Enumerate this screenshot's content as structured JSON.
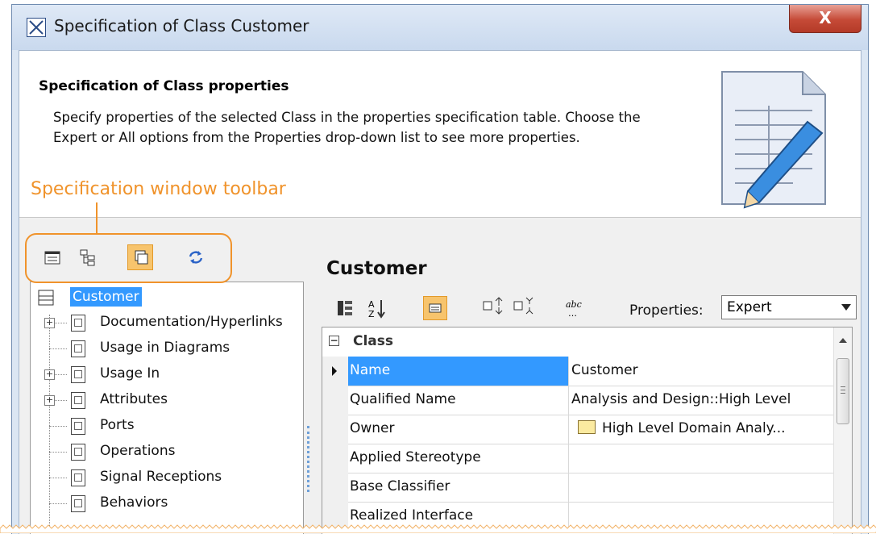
{
  "window": {
    "title": "Specification of Class Customer",
    "close_label": "X"
  },
  "header": {
    "title": "Specification of Class properties",
    "description": "Specify properties of the selected Class in the properties specification table. Choose the Expert or All options from the Properties drop-down list to see more properties."
  },
  "annotation": {
    "label": "Specification window toolbar",
    "color": "#f0932b"
  },
  "toolbar": {
    "buttons": [
      {
        "icon": "show-properties-icon",
        "active": false
      },
      {
        "icon": "show-tree-icon",
        "active": false
      },
      {
        "icon": "restore-window-icon",
        "active": true
      },
      {
        "icon": "refresh-icon",
        "active": false
      }
    ]
  },
  "tree": {
    "root": "Customer",
    "items": [
      {
        "label": "Documentation/Hyperlinks",
        "expandable": true
      },
      {
        "label": "Usage in Diagrams",
        "expandable": false
      },
      {
        "label": "Usage In",
        "expandable": true
      },
      {
        "label": "Attributes",
        "expandable": true
      },
      {
        "label": "Ports",
        "expandable": false
      },
      {
        "label": "Operations",
        "expandable": false
      },
      {
        "label": "Signal Receptions",
        "expandable": false
      },
      {
        "label": "Behaviors",
        "expandable": false
      }
    ]
  },
  "spec": {
    "title": "Customer",
    "properties_label": "Properties:",
    "properties_value": "Expert",
    "group": "Class",
    "rows": [
      {
        "name": "Name",
        "value": "Customer",
        "selected": true
      },
      {
        "name": "Qualified Name",
        "value": "Analysis and Design::High Level",
        "selected": false
      },
      {
        "name": "Owner",
        "value": "High Level Domain Analy...",
        "selected": false
      },
      {
        "name": "Applied Stereotype",
        "value": "",
        "selected": false
      },
      {
        "name": "Base Classifier",
        "value": "",
        "selected": false
      },
      {
        "name": "Realized Interface",
        "value": "",
        "selected": false
      }
    ]
  },
  "colors": {
    "selection": "#3399ff",
    "active_button": "#f7c46d",
    "close_button": "#c54a37"
  }
}
